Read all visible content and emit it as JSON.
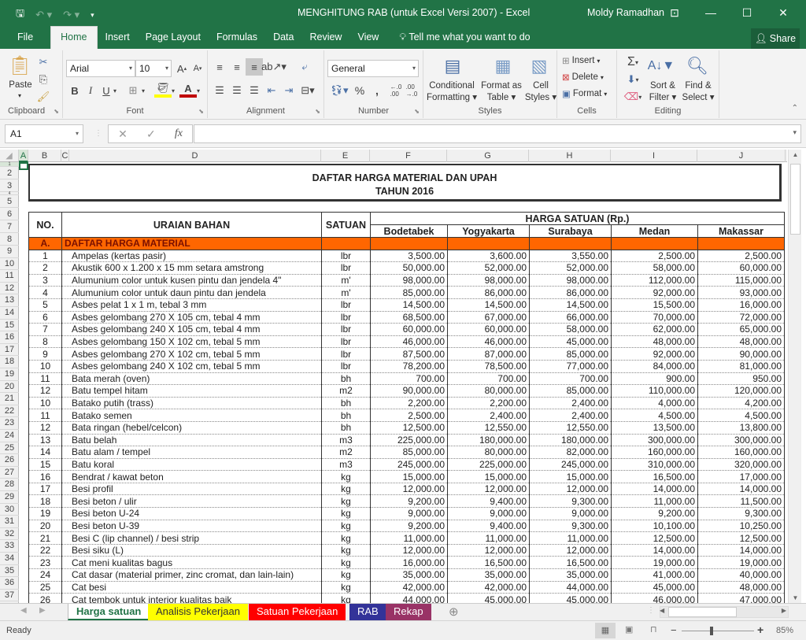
{
  "window": {
    "title": "MENGHITUNG RAB (untuk Excel Versi 2007)  -  Excel",
    "user": "Moldy Ramadhan",
    "icons": [
      "save-icon",
      "undo-icon",
      "redo-icon",
      "customize-qat-icon",
      "ribbon-display-icon",
      "minimize-icon",
      "maximize-icon",
      "close-icon"
    ]
  },
  "ribbon_tabs": [
    "File",
    "Home",
    "Insert",
    "Page Layout",
    "Formulas",
    "Data",
    "Review",
    "View"
  ],
  "active_tab": "Home",
  "tell_me": "Tell me what you want to do",
  "share_label": "Share",
  "ribbon": {
    "clipboard": {
      "label": "Clipboard",
      "paste": "Paste"
    },
    "font": {
      "label": "Font",
      "name": "Arial",
      "size": "10",
      "bold": "B",
      "italic": "I",
      "underline": "U",
      "grow": "A",
      "shrink": "A",
      "fill_color": "#ffff00",
      "font_color": "#c00000"
    },
    "alignment": {
      "label": "Alignment"
    },
    "number": {
      "label": "Number",
      "format": "General",
      "percent": "%",
      "comma": ","
    },
    "styles": {
      "label": "Styles",
      "conditional": [
        "Conditional",
        "Formatting ▾"
      ],
      "format_table": [
        "Format as",
        "Table ▾"
      ],
      "cell_styles": [
        "Cell",
        "Styles ▾"
      ]
    },
    "cells": {
      "label": "Cells",
      "insert": "Insert",
      "delete": "Delete",
      "format": "Format"
    },
    "editing": {
      "label": "Editing",
      "sort": [
        "Sort &",
        "Filter ▾"
      ],
      "find": [
        "Find &",
        "Select ▾"
      ]
    }
  },
  "formula_bar": {
    "name_box": "A1",
    "formula": ""
  },
  "columns": [
    "A",
    "B",
    "C",
    "D",
    "E",
    "F",
    "G",
    "H",
    "I",
    "J"
  ],
  "rows": [
    "1",
    "2",
    "3",
    "4",
    "5",
    "6",
    "7",
    "8",
    "9",
    "10",
    "11",
    "12",
    "13",
    "14",
    "15",
    "16",
    "17",
    "18",
    "19",
    "20",
    "21",
    "22",
    "23",
    "24",
    "25",
    "26",
    "27",
    "28",
    "29",
    "30",
    "31",
    "32",
    "33",
    "34",
    "35",
    "36",
    "37"
  ],
  "sheet": {
    "title1": "DAFTAR  HARGA  MATERIAL DAN UPAH",
    "title2": "TAHUN 2016",
    "headers": {
      "no": "NO.",
      "uraian": "URAIAN BAHAN",
      "satuan": "SATUAN",
      "harga": "HARGA SATUAN (Rp.)",
      "cities": [
        "Bodetabek",
        "Yogyakarta",
        "Surabaya",
        "Medan",
        "Makassar"
      ]
    },
    "section": {
      "code": "A.",
      "label": "DAFTAR HARGA MATERIAL",
      "color": "#ff6600"
    },
    "items": [
      {
        "no": "1",
        "name": "Ampelas (kertas pasir)",
        "unit": "lbr",
        "prices": [
          "3,500.00",
          "3,600.00",
          "3,550.00",
          "2,500.00",
          "2,500.00"
        ]
      },
      {
        "no": "2",
        "name": "Akustik 600 x 1.200 x 15 mm setara amstrong",
        "unit": "lbr",
        "prices": [
          "50,000.00",
          "52,000.00",
          "52,000.00",
          "58,000.00",
          "60,000.00"
        ]
      },
      {
        "no": "3",
        "name": "Alumunium color untuk kusen pintu dan jendela 4\"",
        "unit": "m'",
        "prices": [
          "98,000.00",
          "98,000.00",
          "98,000.00",
          "112,000.00",
          "115,000.00"
        ]
      },
      {
        "no": "4",
        "name": "Alumunium color untuk daun pintu dan jendela",
        "unit": "m'",
        "prices": [
          "85,000.00",
          "86,000.00",
          "86,000.00",
          "92,000.00",
          "93,000.00"
        ]
      },
      {
        "no": "5",
        "name": "Asbes pelat 1 x 1 m, tebal 3 mm",
        "unit": "lbr",
        "prices": [
          "14,500.00",
          "14,500.00",
          "14,500.00",
          "15,500.00",
          "16,000.00"
        ]
      },
      {
        "no": "6",
        "name": "Asbes gelombang 270 X 105 cm, tebal 4 mm",
        "unit": "lbr",
        "prices": [
          "68,500.00",
          "67,000.00",
          "66,000.00",
          "70,000.00",
          "72,000.00"
        ]
      },
      {
        "no": "7",
        "name": "Asbes gelombang 240 X 105 cm, tebal 4 mm",
        "unit": "lbr",
        "prices": [
          "60,000.00",
          "60,000.00",
          "58,000.00",
          "62,000.00",
          "65,000.00"
        ]
      },
      {
        "no": "8",
        "name": "Asbes gelombang 150 X 102 cm, tebal 5 mm",
        "unit": "lbr",
        "prices": [
          "46,000.00",
          "46,000.00",
          "45,000.00",
          "48,000.00",
          "48,000.00"
        ]
      },
      {
        "no": "9",
        "name": "Asbes gelombang 270 X 102 cm, tebal 5 mm",
        "unit": "lbr",
        "prices": [
          "87,500.00",
          "87,000.00",
          "85,000.00",
          "92,000.00",
          "90,000.00"
        ]
      },
      {
        "no": "10",
        "name": "Asbes gelombang 240 X 102 cm, tebal 5 mm",
        "unit": "lbr",
        "prices": [
          "78,200.00",
          "78,500.00",
          "77,000.00",
          "84,000.00",
          "81,000.00"
        ]
      },
      {
        "no": "11",
        "name": "Bata merah (oven)",
        "unit": "bh",
        "prices": [
          "700.00",
          "700.00",
          "700.00",
          "900.00",
          "950.00"
        ]
      },
      {
        "no": "12",
        "name": "Batu tempel hitam",
        "unit": "m2",
        "prices": [
          "90,000.00",
          "80,000.00",
          "85,000.00",
          "110,000.00",
          "120,000.00"
        ]
      },
      {
        "no": "10",
        "name": "Batako putih (trass)",
        "unit": "bh",
        "prices": [
          "2,200.00",
          "2,200.00",
          "2,400.00",
          "4,000.00",
          "4,200.00"
        ]
      },
      {
        "no": "11",
        "name": "Batako semen",
        "unit": "bh",
        "prices": [
          "2,500.00",
          "2,400.00",
          "2,400.00",
          "4,500.00",
          "4,500.00"
        ]
      },
      {
        "no": "12",
        "name": "Bata ringan (hebel/celcon)",
        "unit": "bh",
        "prices": [
          "12,500.00",
          "12,550.00",
          "12,550.00",
          "13,500.00",
          "13,800.00"
        ]
      },
      {
        "no": "13",
        "name": "Batu belah",
        "unit": "m3",
        "prices": [
          "225,000.00",
          "180,000.00",
          "180,000.00",
          "300,000.00",
          "300,000.00"
        ]
      },
      {
        "no": "14",
        "name": "Batu alam / tempel",
        "unit": "m2",
        "prices": [
          "85,000.00",
          "80,000.00",
          "82,000.00",
          "160,000.00",
          "160,000.00"
        ]
      },
      {
        "no": "15",
        "name": "Batu koral",
        "unit": "m3",
        "prices": [
          "245,000.00",
          "225,000.00",
          "245,000.00",
          "310,000.00",
          "320,000.00"
        ]
      },
      {
        "no": "16",
        "name": "Bendrat / kawat beton",
        "unit": "kg",
        "prices": [
          "15,000.00",
          "15,000.00",
          "15,000.00",
          "16,500.00",
          "17,000.00"
        ]
      },
      {
        "no": "17",
        "name": "Besi profil",
        "unit": "kg",
        "prices": [
          "12,000.00",
          "12,000.00",
          "12,000.00",
          "14,000.00",
          "14,000.00"
        ]
      },
      {
        "no": "18",
        "name": "Besi beton / ulir",
        "unit": "kg",
        "prices": [
          "9,200.00",
          "9,400.00",
          "9,300.00",
          "11,000.00",
          "11,500.00"
        ]
      },
      {
        "no": "19",
        "name": "Besi beton  U-24",
        "unit": "kg",
        "prices": [
          "9,000.00",
          "9,000.00",
          "9,000.00",
          "9,200.00",
          "9,300.00"
        ]
      },
      {
        "no": "20",
        "name": "Besi beton  U-39",
        "unit": "kg",
        "prices": [
          "9,200.00",
          "9,400.00",
          "9,300.00",
          "10,100.00",
          "10,250.00"
        ]
      },
      {
        "no": "21",
        "name": "Besi C (lip channel) / besi strip",
        "unit": "kg",
        "prices": [
          "11,000.00",
          "11,000.00",
          "11,000.00",
          "12,500.00",
          "12,500.00"
        ]
      },
      {
        "no": "22",
        "name": "Besi siku (L)",
        "unit": "kg",
        "prices": [
          "12,000.00",
          "12,000.00",
          "12,000.00",
          "14,000.00",
          "14,000.00"
        ]
      },
      {
        "no": "23",
        "name": "Cat meni kualitas bagus",
        "unit": "kg",
        "prices": [
          "16,000.00",
          "16,500.00",
          "16,500.00",
          "19,000.00",
          "19,000.00"
        ]
      },
      {
        "no": "24",
        "name": "Cat dasar (material primer, zinc cromat, dan lain-lain)",
        "unit": "kg",
        "prices": [
          "35,000.00",
          "35,000.00",
          "35,000.00",
          "41,000.00",
          "40,000.00"
        ]
      },
      {
        "no": "25",
        "name": "Cat  besi",
        "unit": "kg",
        "prices": [
          "42,000.00",
          "42,000.00",
          "44,000.00",
          "45,000.00",
          "48,000.00"
        ]
      },
      {
        "no": "26",
        "name": "Cat tembok  untuk interior kualitas baik",
        "unit": "kg",
        "prices": [
          "44,000.00",
          "45,000.00",
          "45,000.00",
          "46,000.00",
          "47,000.00"
        ]
      }
    ]
  },
  "sheet_tabs": [
    {
      "label": "Harga satuan",
      "bg": "#ffffff",
      "fg": "#217346",
      "active": true
    },
    {
      "label": "Analisis Pekerjaan",
      "bg": "#ffff00",
      "fg": "#333333",
      "active": false
    },
    {
      "label": "Satuan Pekerjaan",
      "bg": "#ff0000",
      "fg": "#ffffff",
      "active": false
    },
    {
      "label": "RAB",
      "bg": "#333399",
      "fg": "#ffffff",
      "active": false
    },
    {
      "label": "Rekap",
      "bg": "#993366",
      "fg": "#ffffff",
      "active": false
    }
  ],
  "status": {
    "mode": "Ready",
    "zoom": "85%",
    "zoom_minus": "−",
    "zoom_plus": "+"
  }
}
